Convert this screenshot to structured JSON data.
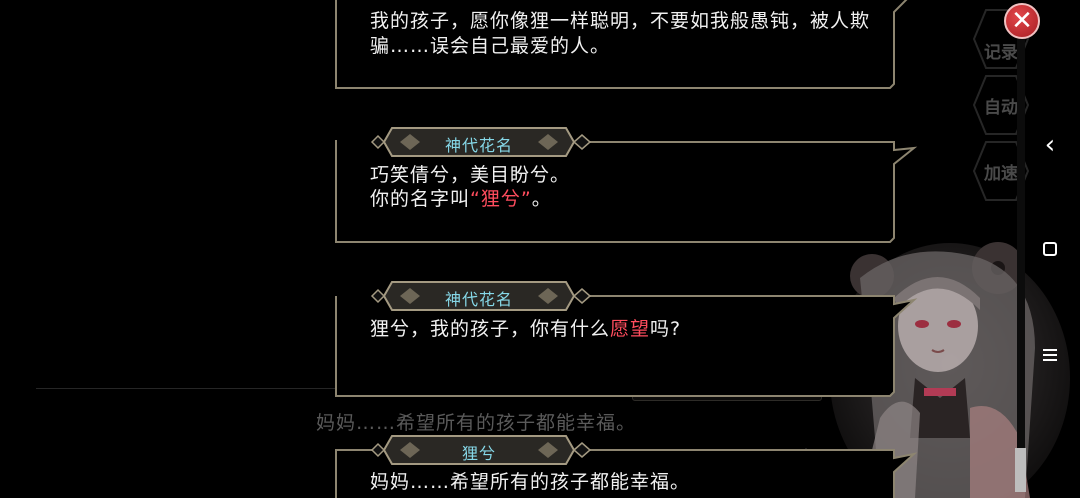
{
  "background_dialog": {
    "speaker": "狸兮",
    "text": "妈妈……希望所有的孩子都能幸福。"
  },
  "log": [
    {
      "speaker": "",
      "lines": [
        [
          {
            "t": "我的孩子，愿你像狸一样聪明，不要如我般愚钝，被人欺"
          }
        ],
        [
          {
            "t": "骗……误会自己最爱的人。"
          }
        ]
      ]
    },
    {
      "speaker": "神代花名",
      "lines": [
        [
          {
            "t": "巧笑倩兮，美目盼兮。"
          }
        ],
        [
          {
            "t": "你的名字叫"
          },
          {
            "t": "“狸兮”",
            "hl": true
          },
          {
            "t": "。"
          }
        ]
      ]
    },
    {
      "speaker": "神代花名",
      "lines": [
        [
          {
            "t": "狸兮，我的孩子，你有什么"
          },
          {
            "t": "愿望",
            "hl": true
          },
          {
            "t": "吗?"
          }
        ]
      ]
    },
    {
      "speaker": "狸兮",
      "lines": [
        [
          {
            "t": "妈妈……希望所有的孩子都能幸福。"
          }
        ]
      ]
    }
  ],
  "side_menu": {
    "log_label": "记录",
    "auto_label": "自动",
    "speed_label": "加速"
  },
  "close_label": "✕",
  "colors": {
    "frame": "#8d8570",
    "name_text": "#86d8e8",
    "highlight": "#ff4d5e",
    "close_red": "#c9282d"
  }
}
